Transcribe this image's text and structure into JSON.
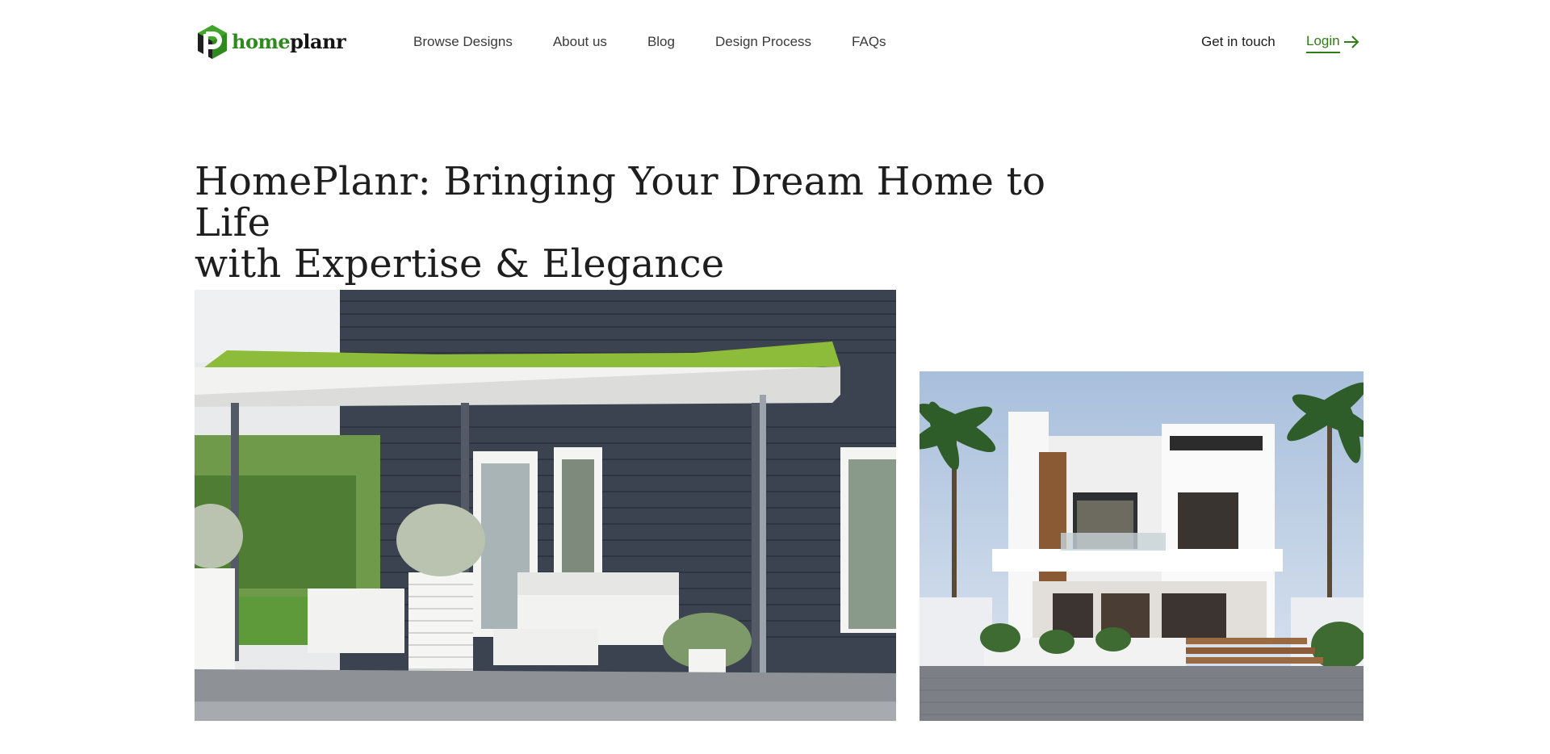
{
  "brand": {
    "name_part1": "home",
    "name_part2": "planr",
    "accent_color": "#2f8a1e"
  },
  "nav": {
    "items": [
      {
        "label": "Browse Designs"
      },
      {
        "label": "About us"
      },
      {
        "label": "Blog"
      },
      {
        "label": "Design Process"
      },
      {
        "label": "FAQs"
      }
    ]
  },
  "header_actions": {
    "contact_label": "Get in touch",
    "login_label": "Login",
    "login_icon": "arrow-right-icon"
  },
  "hero": {
    "title_line1": "HomePlanr: Bringing Your Dream Home to Life",
    "title_line2": "with Expertise & Elegance"
  },
  "images": [
    {
      "subject": "dark-clapboard-house-with-green-roof-porch-photo"
    },
    {
      "subject": "modern-white-two-storey-villa-with-palms-photo"
    }
  ]
}
